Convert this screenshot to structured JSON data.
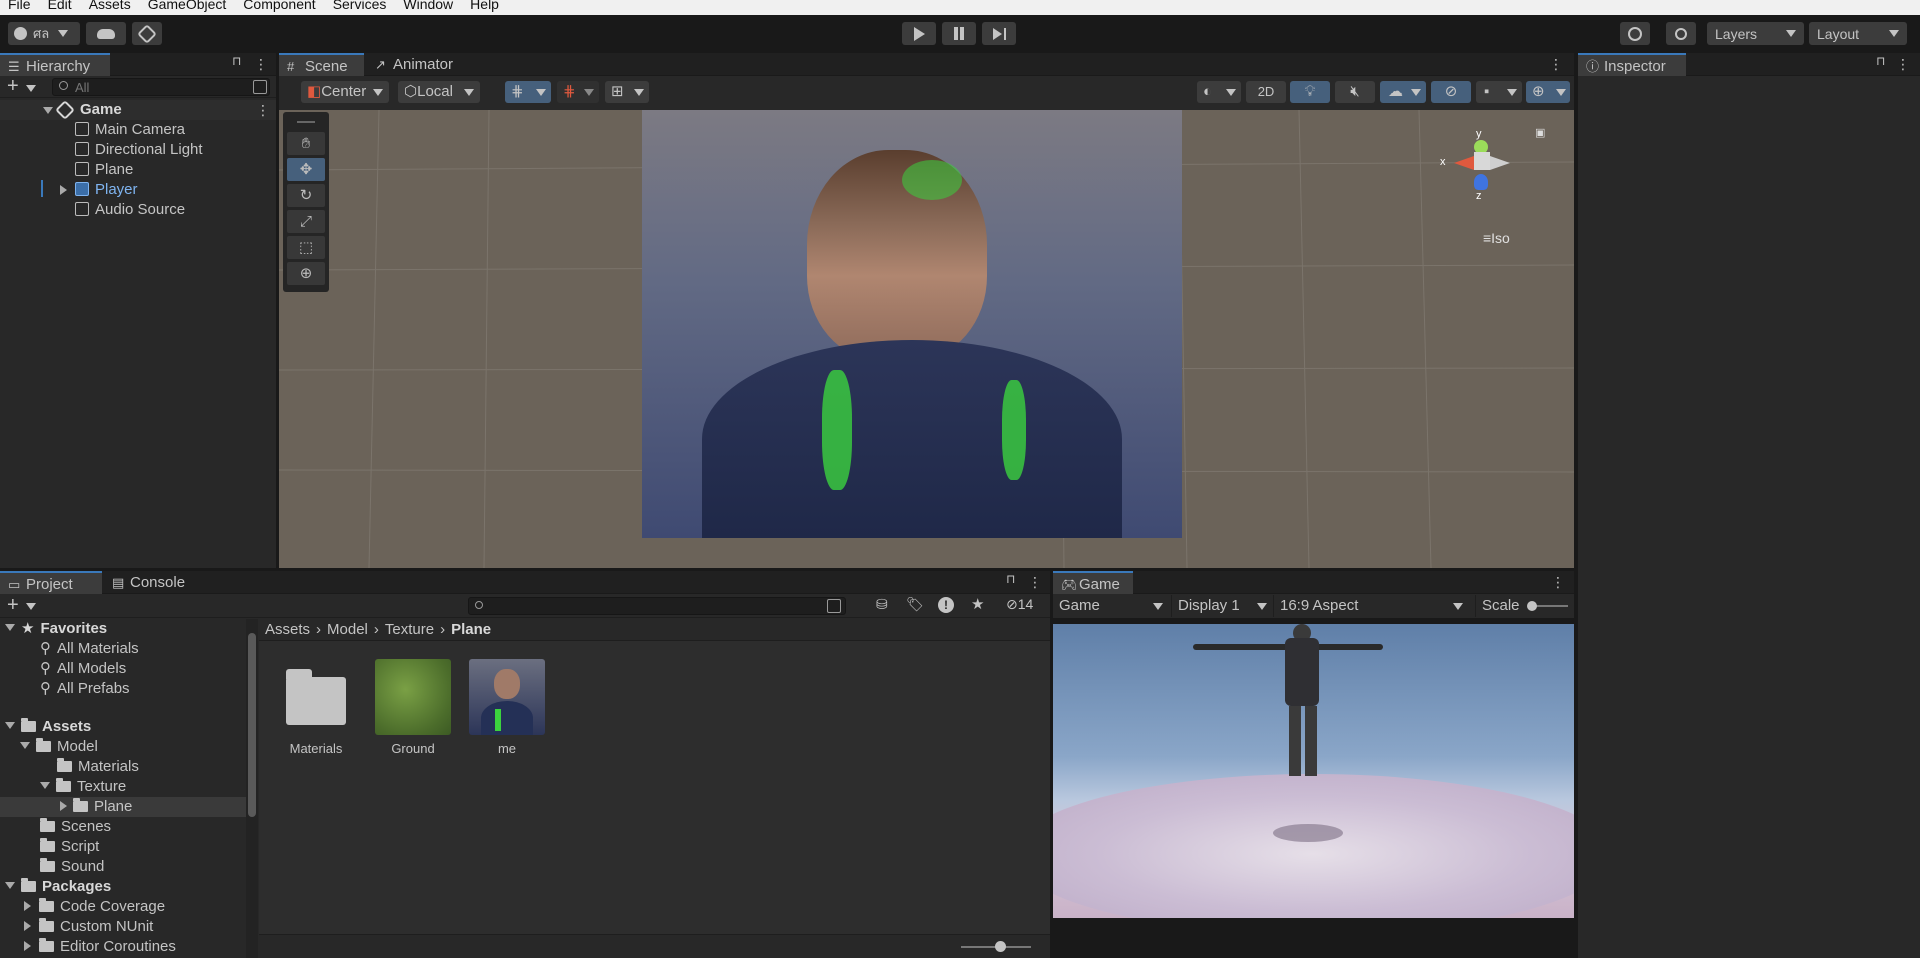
{
  "menubar": {
    "items": [
      "File",
      "Edit",
      "Assets",
      "GameObject",
      "Component",
      "Services",
      "Window",
      "Help"
    ]
  },
  "toolbar": {
    "account_label": "ศล",
    "cloud_icon": "cloud-icon",
    "services_icon": "services-icon",
    "play_icon": "play-icon",
    "pause_icon": "pause-icon",
    "step_icon": "step-icon",
    "history_icon": "history-icon",
    "search_icon": "search-icon",
    "layers_label": "Layers",
    "layout_label": "Layout"
  },
  "hierarchy": {
    "tab_label": "Hierarchy",
    "search_placeholder": "All",
    "scene_name": "Game",
    "items": [
      {
        "label": "Main Camera",
        "selected": false
      },
      {
        "label": "Directional Light",
        "selected": false
      },
      {
        "label": "Plane",
        "selected": false
      },
      {
        "label": "Player",
        "selected": false,
        "prefab": true
      },
      {
        "label": "Audio Source",
        "selected": false
      }
    ]
  },
  "scene": {
    "tabs": [
      {
        "label": "Scene"
      },
      {
        "label": "Animator"
      }
    ],
    "pivot_label": "Center",
    "space_label": "Local",
    "mode_2d_label": "2D",
    "gizmo_projection_label": "Iso",
    "gizmo_axes": {
      "x": "x",
      "y": "y",
      "z": "z"
    }
  },
  "inspector": {
    "tab_label": "Inspector"
  },
  "project": {
    "tabs": [
      {
        "label": "Project"
      },
      {
        "label": "Console"
      }
    ],
    "hidden_count": "14",
    "favorites_label": "Favorites",
    "favorites": [
      "All Materials",
      "All Models",
      "All Prefabs"
    ],
    "assets_label": "Assets",
    "asset_tree": [
      {
        "label": "Model",
        "depth": 1,
        "expanded": true
      },
      {
        "label": "Materials",
        "depth": 2
      },
      {
        "label": "Texture",
        "depth": 2,
        "expanded": true
      },
      {
        "label": "Plane",
        "depth": 3,
        "selected": true
      },
      {
        "label": "Scenes",
        "depth": 1
      },
      {
        "label": "Script",
        "depth": 1
      },
      {
        "label": "Sound",
        "depth": 1
      }
    ],
    "packages_label": "Packages",
    "packages": [
      "Code Coverage",
      "Custom NUnit",
      "Editor Coroutines"
    ],
    "breadcrumb": [
      "Assets",
      "Model",
      "Texture",
      "Plane"
    ],
    "assets": [
      {
        "label": "Materials",
        "kind": "folder"
      },
      {
        "label": "Ground",
        "kind": "texture"
      },
      {
        "label": "me",
        "kind": "texture"
      }
    ]
  },
  "game": {
    "tab_label": "Game",
    "mode_label": "Game",
    "display_label": "Display 1",
    "aspect_label": "16:9 Aspect",
    "scale_label": "Scale"
  },
  "colors": {
    "accent": "#3a79bb",
    "panel": "#282828",
    "tab_active": "#3c3c3c",
    "selected_text": "#7fb4f0"
  }
}
